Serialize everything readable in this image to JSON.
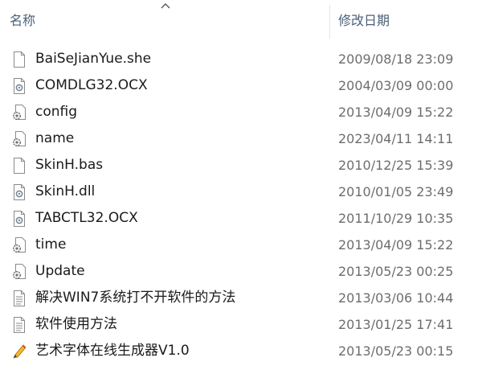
{
  "header": {
    "name_label": "名称",
    "date_label": "修改日期",
    "sort_indicator": "chevron-up-icon"
  },
  "files": [
    {
      "name": "BaiSeJianYue.she",
      "date": "2009/08/18 23:09",
      "icon": "blank-file-icon"
    },
    {
      "name": "COMDLG32.OCX",
      "date": "2004/03/09 00:00",
      "icon": "system-file-icon"
    },
    {
      "name": "config",
      "date": "2013/04/09 15:22",
      "icon": "settings-file-icon"
    },
    {
      "name": "name",
      "date": "2023/04/11 14:11",
      "icon": "settings-file-icon"
    },
    {
      "name": "SkinH.bas",
      "date": "2010/12/25 15:39",
      "icon": "blank-file-icon"
    },
    {
      "name": "SkinH.dll",
      "date": "2010/01/05 23:49",
      "icon": "system-file-icon"
    },
    {
      "name": "TABCTL32.OCX",
      "date": "2011/10/29 10:35",
      "icon": "system-file-icon"
    },
    {
      "name": "time",
      "date": "2013/04/09 15:22",
      "icon": "settings-file-icon"
    },
    {
      "name": "Update",
      "date": "2013/05/23 00:25",
      "icon": "settings-file-icon"
    },
    {
      "name": "解决WIN7系统打不开软件的方法",
      "date": "2013/03/06 10:44",
      "icon": "text-file-icon"
    },
    {
      "name": "软件使用方法",
      "date": "2013/01/25 17:41",
      "icon": "text-file-icon"
    },
    {
      "name": "艺术字体在线生成器V1.0",
      "date": "2013/05/23 00:15",
      "icon": "application-icon"
    }
  ]
}
